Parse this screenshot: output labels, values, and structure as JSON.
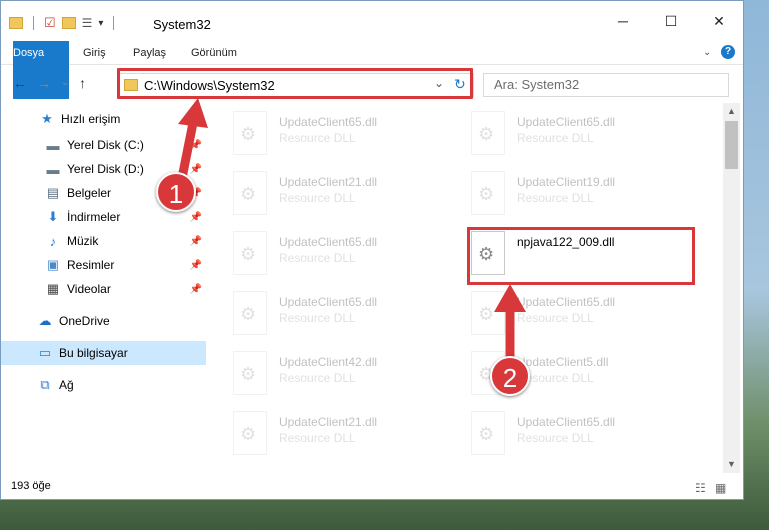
{
  "window": {
    "title": "System32",
    "minimize": "─",
    "maximize": "☐",
    "close": "✕"
  },
  "ribbon": {
    "tabs": [
      "Dosya",
      "Giriş",
      "Paylaş",
      "Görünüm"
    ],
    "help": "?"
  },
  "address": {
    "path": "C:\\Windows\\System32",
    "refresh": "↻",
    "dropdown": "⌄",
    "search_placeholder": "Ara: System32"
  },
  "nav": {
    "back": "←",
    "forward": "→",
    "recent": "⌄",
    "up": "↑"
  },
  "sidebar": {
    "items": [
      {
        "label": "Hızlı erişim",
        "icon": "star-icon",
        "glyph": "★",
        "pinned": false
      },
      {
        "label": "Yerel Disk (C:)",
        "icon": "drive-icon",
        "glyph": "▬",
        "pinned": true
      },
      {
        "label": "Yerel Disk (D:)",
        "icon": "drive-icon",
        "glyph": "▬",
        "pinned": true
      },
      {
        "label": "Belgeler",
        "icon": "documents-icon",
        "glyph": "▤",
        "pinned": true
      },
      {
        "label": "İndirmeler",
        "icon": "download-icon",
        "glyph": "⬇",
        "pinned": true
      },
      {
        "label": "Müzik",
        "icon": "music-icon",
        "glyph": "♪",
        "pinned": true
      },
      {
        "label": "Resimler",
        "icon": "pictures-icon",
        "glyph": "▣",
        "pinned": true
      },
      {
        "label": "Videolar",
        "icon": "video-icon",
        "glyph": "▦",
        "pinned": true
      },
      {
        "label": "OneDrive",
        "icon": "cloud-icon",
        "glyph": "☁",
        "pinned": false
      },
      {
        "label": "Bu bilgisayar",
        "icon": "computer-icon",
        "glyph": "▭",
        "pinned": false
      },
      {
        "label": "Ağ",
        "icon": "network-icon",
        "glyph": "⧉",
        "pinned": false
      }
    ]
  },
  "files": {
    "left_column": [
      {
        "name": "UpdateClient65.dll",
        "type": "Resource DLL"
      },
      {
        "name": "UpdateClient21.dll",
        "type": "Resource DLL"
      },
      {
        "name": "UpdateClient65.dll",
        "type": "Resource DLL"
      },
      {
        "name": "UpdateClient65.dll",
        "type": "Resource DLL"
      },
      {
        "name": "UpdateClient42.dll",
        "type": "Resource DLL"
      },
      {
        "name": "UpdateClient21.dll",
        "type": "Resource DLL"
      }
    ],
    "right_column": [
      {
        "name": "UpdateClient65.dll",
        "type": "Resource DLL",
        "faded": true
      },
      {
        "name": "UpdateClient19.dll",
        "type": "Resource DLL",
        "faded": true
      },
      {
        "name": "npjava122_009.dll",
        "type": "",
        "faded": false
      },
      {
        "name": "UpdateClient65.dll",
        "type": "Resource DLL",
        "faded": true
      },
      {
        "name": "UpdateClient5.dll",
        "type": "Resource DLL",
        "faded": true
      },
      {
        "name": "UpdateClient65.dll",
        "type": "Resource DLL",
        "faded": true
      }
    ]
  },
  "status": {
    "count": "193 öğe"
  },
  "annotations": {
    "step1": "1",
    "step2": "2",
    "color": "#d9383b"
  },
  "colors": {
    "accent": "#1979ca",
    "selected": "#cce8ff",
    "highlight": "#d9383b"
  }
}
